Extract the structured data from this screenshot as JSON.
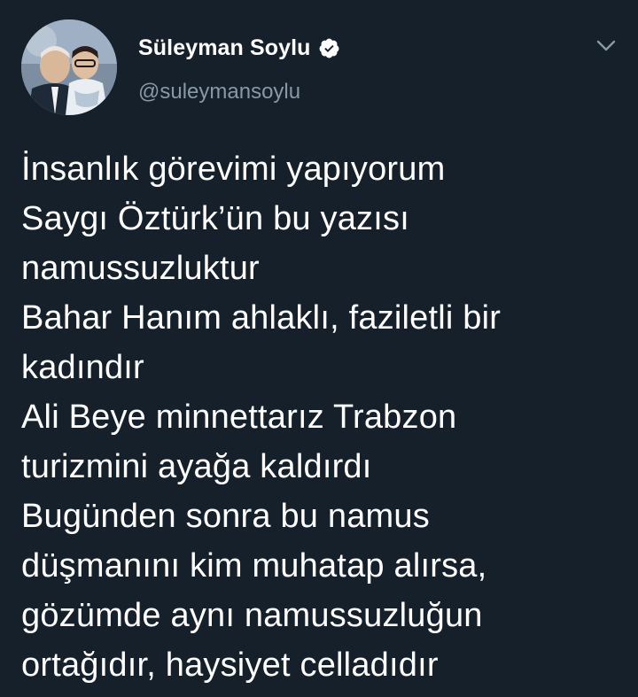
{
  "author": {
    "display_name": "Süleyman Soylu",
    "handle": "@suleymansoylu",
    "verified": true
  },
  "icons": {
    "avatar": "profile-photo",
    "verified": "verified-badge-icon",
    "menu": "chevron-down-icon"
  },
  "tweet": {
    "lines": [
      "İnsanlık görevimi yapıyorum",
      "Saygı Öztürk’ün bu yazısı",
      "namussuzluktur",
      "Bahar Hanım ahlaklı, faziletli bir",
      "kadındır",
      "Ali Beye minnettarız Trabzon",
      "turizmini ayağa kaldırdı",
      "Bugünden sonra bu namus",
      "düşmanını kim muhatap alırsa,",
      "gözümde aynı namussuzluğun",
      "ortağıdır, haysiyet celladıdır"
    ]
  },
  "colors": {
    "background": "#15202b",
    "text": "#ffffff",
    "secondary_text": "#8899a6"
  }
}
